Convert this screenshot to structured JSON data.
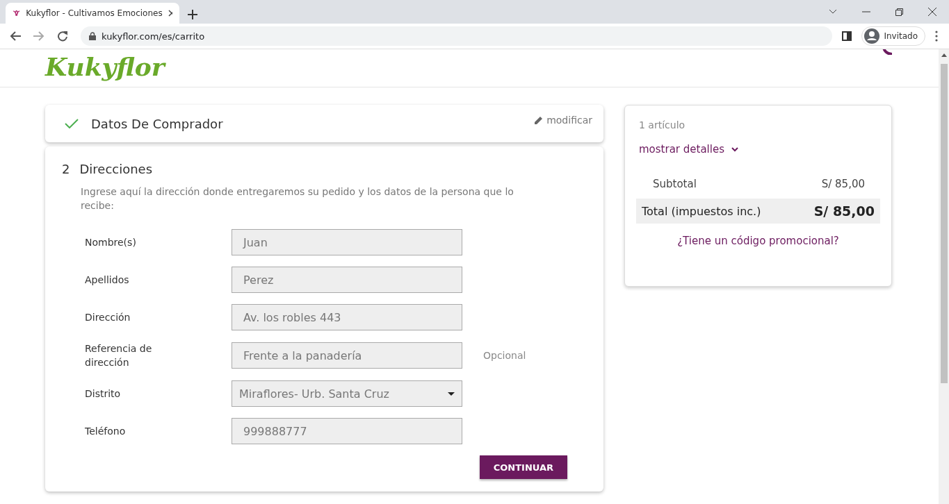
{
  "browser": {
    "tab_title": "Kukyflor - Cultivamos Emociones",
    "url": "kukyflor.com/es/carrito",
    "profile": "Invitado"
  },
  "header": {
    "logo": "Kukyflor"
  },
  "buyer_step": {
    "title": "Datos De Comprador",
    "completed": true,
    "edit_link": "modificar"
  },
  "address_step": {
    "number": "2",
    "title": "Direcciones",
    "description": "Ingrese aquí la dirección donde entregaremos su pedido y los datos de la persona que lo recibe:",
    "fields": [
      {
        "kind": "text",
        "label": "Nombre(s)",
        "value": "Juan"
      },
      {
        "kind": "text",
        "label": "Apellidos",
        "value": "Perez"
      },
      {
        "kind": "text",
        "label": "Dirección",
        "value": "Av. los robles 443"
      },
      {
        "kind": "text",
        "label": "Referencia de dirección",
        "value": "Frente a la panadería",
        "note": "Opcional"
      },
      {
        "kind": "select",
        "label": "Distrito",
        "value": "Miraflores- Urb. Santa Cruz"
      },
      {
        "kind": "text",
        "label": "Teléfono",
        "value": "999888777"
      }
    ],
    "submit": "CONTINUAR"
  },
  "summary": {
    "count": "1 artículo",
    "details_link": "mostrar detalles",
    "subtotal_label": "Subtotal",
    "subtotal": "S/ 85,00",
    "total_label": "Total (impuestos inc.)",
    "total": "S/ 85,00",
    "promo_link": "¿Tiene un código promocional?"
  }
}
